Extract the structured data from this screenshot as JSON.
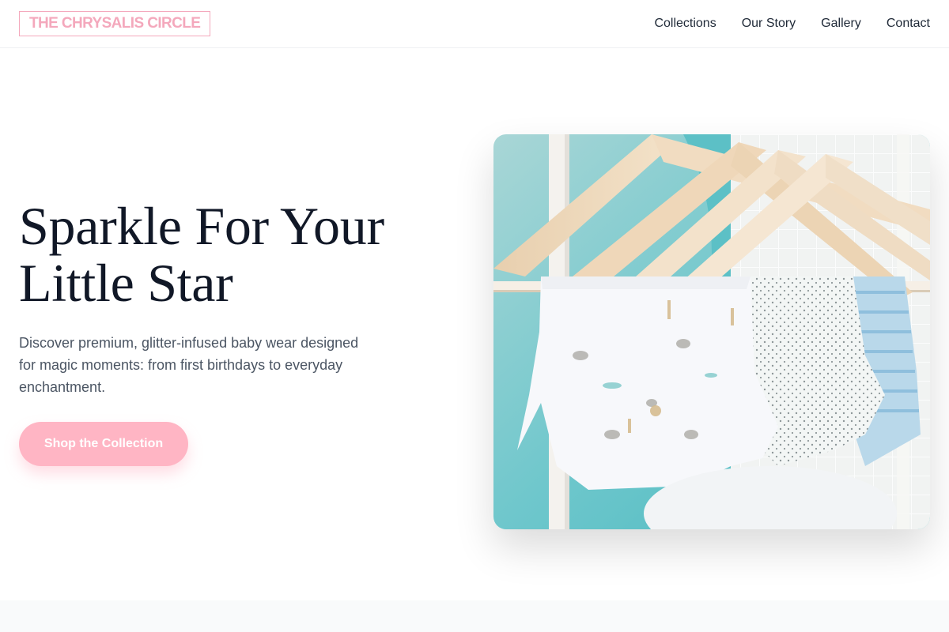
{
  "brand": {
    "name": "THE CHRYSALIS CIRCLE",
    "color": "#f4a8bc"
  },
  "nav": {
    "items": [
      {
        "label": "Collections"
      },
      {
        "label": "Our Story"
      },
      {
        "label": "Gallery"
      },
      {
        "label": "Contact"
      }
    ]
  },
  "hero": {
    "title_line1": "Sparkle For Your",
    "title_line2": "Little Star",
    "description": "Discover premium, glitter-infused baby wear designed for magic moments: from first birthdays to everyday enchantment.",
    "cta_label": "Shop the Collection",
    "cta_color": "#ffb5c4",
    "image_icon": "baby-clothes-on-hangers-photo"
  }
}
